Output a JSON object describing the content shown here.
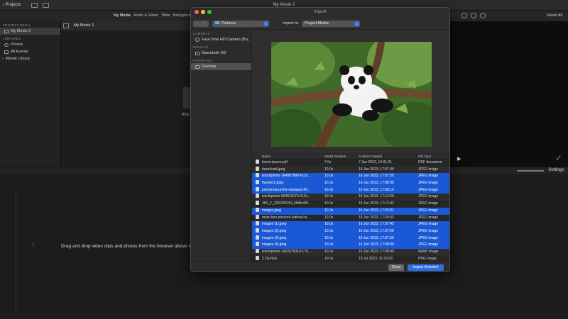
{
  "window": {
    "back_label": "Projects",
    "title": "My Movie 2"
  },
  "toolbar": {
    "tabs": [
      "My Media",
      "Audio & Video",
      "Titles",
      "Backgrounds"
    ],
    "reset_label": "Reset All"
  },
  "sidebar": {
    "project_media_header": "PROJECT MEDIA",
    "project_item": "My Movie 2",
    "libraries_header": "LIBRARIES",
    "library_items": [
      "Photos",
      "All Events",
      "iMovie Library"
    ]
  },
  "browser": {
    "title": "My Movie 2",
    "peek_text": "Imp"
  },
  "timeline": {
    "settings_label": "Settings",
    "hint": "Drag and drop video clips and photos from the browser above to"
  },
  "dialog": {
    "title": "Import",
    "location": "Pictures",
    "import_to_label": "Import to:",
    "import_to_value": "Project Media",
    "sidebar": {
      "cameras_header": "CAMERAS",
      "camera_item": "FaceTime HD Camera (Bu...",
      "devices_header": "DEVICES",
      "device_item": "Macintosh HD",
      "favorites_header": "FAVORITES",
      "favorite_item": "Desktop"
    },
    "columns": [
      "Name",
      "Media Duration",
      "Content Created",
      "File Type"
    ],
    "files": [
      {
        "name": "lorem-ipsum.pdf",
        "duration": "7.0s",
        "created": "7 Jun 2023, 14:01:21",
        "type": "PDF document",
        "selected": false
      },
      {
        "name": "download.jpeg",
        "duration": "10.0s",
        "created": "16 Jun 2023, 17:07:39",
        "type": "JPEG image",
        "selected": false
      },
      {
        "name": "istockphoto-164987980-612x...",
        "duration": "10.0s",
        "created": "16 Jun 2023, 17:07:55",
        "type": "JPEG image",
        "selected": true
      },
      {
        "name": "thumb10.jpeg",
        "duration": "10.0s",
        "created": "16 Jun 2023, 17:08:00",
        "type": "JPEG image",
        "selected": true
      },
      {
        "name": "pexels-laura-the-explaura-36...",
        "duration": "10.0s",
        "created": "16 Jun 2023, 17:08:14",
        "type": "JPEG image",
        "selected": true
      },
      {
        "name": "istockphoto-964811070-612x...",
        "duration": "10.0s",
        "created": "16 Jun 2023, 17:12:26",
        "type": "JPEG image",
        "selected": false
      },
      {
        "name": "360_F_292290144_4fdRm99...",
        "duration": "10.0s",
        "created": "16 Jun 2023, 17:12:42",
        "type": "JPEG image",
        "selected": false
      },
      {
        "name": "images.jpeg",
        "duration": "10.0s",
        "created": "16 Jun 2023, 17:23:31",
        "type": "JPEG image",
        "selected": true
      },
      {
        "name": "mule-free-pictures-without-w...",
        "duration": "10.0s",
        "created": "16 Jun 2023, 17:24:03",
        "type": "JPEG image",
        "selected": false
      },
      {
        "name": "images (1).jpeg",
        "duration": "10.0s",
        "created": "16 Jun 2023, 17:37:42",
        "type": "JPEG image",
        "selected": true
      },
      {
        "name": "images (2).jpeg",
        "duration": "10.0s",
        "created": "16 Jun 2023, 17:37:50",
        "type": "JPEG image",
        "selected": true
      },
      {
        "name": "images (3).jpeg",
        "duration": "10.0s",
        "created": "16 Jun 2023, 17:37:56",
        "type": "JPEG image",
        "selected": true
      },
      {
        "name": "images (4).jpeg",
        "duration": "10.0s",
        "created": "16 Jun 2023, 17:38:00",
        "type": "JPEG image",
        "selected": true
      },
      {
        "name": "istockphoto-1422876310-170...",
        "duration": "10.0s",
        "created": "16 Jun 2023, 17:38:40",
        "type": "WebP image",
        "selected": false
      },
      {
        "name": "2 DaVinci",
        "duration": "10.0s",
        "created": "19 Jul 2023, 11:23:29",
        "type": "PNG image",
        "selected": false
      }
    ],
    "close_label": "Close",
    "import_label": "Import Selected"
  },
  "colors": {
    "selection_blue": "#1a58d6",
    "button_blue": "#2d6fe6"
  }
}
